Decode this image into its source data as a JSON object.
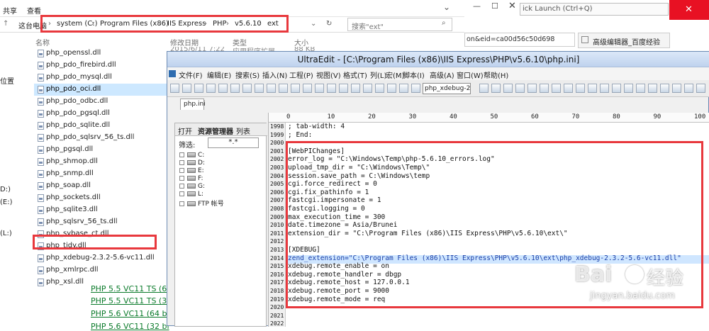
{
  "explorer": {
    "ribbon": {
      "share": "共享",
      "view": "查看"
    },
    "address": {
      "crumbs": [
        "这台电脑",
        "system (C:)",
        "Program Files (x86)",
        "IIS Express",
        "PHP",
        "v5.6.10",
        "ext"
      ],
      "sep": "›"
    },
    "search_placeholder": "搜索\"ext\"",
    "columns": {
      "name": "名称",
      "date": "修改日期",
      "type": "类型",
      "size": "大小"
    },
    "first_row": {
      "date": "2015/6/11 7:22",
      "type": "应用程序扩展",
      "size": "88 KB"
    },
    "nav": [
      "位置",
      "D:)",
      "(E:)",
      "(L:)"
    ],
    "files": [
      "php_openssl.dll",
      "php_pdo_firebird.dll",
      "php_pdo_mysql.dll",
      "php_pdo_oci.dll",
      "php_pdo_odbc.dll",
      "php_pdo_pgsql.dll",
      "php_pdo_sqlite.dll",
      "php_pdo_sqlsrv_56_ts.dll",
      "php_pgsql.dll",
      "php_shmop.dll",
      "php_snmp.dll",
      "php_soap.dll",
      "php_sockets.dll",
      "php_sqlite3.dll",
      "php_sqlsrv_56_ts.dll",
      "php_sybase_ct.dll",
      "php_tidy.dll",
      "php_xdebug-2.3.2-5.6-vc11.dll",
      "php_xmlrpc.dll",
      "php_xsl.dll"
    ],
    "selected_index": 3,
    "highlighted_index": 17,
    "links": [
      "PHP 5.5 VC11 TS (6",
      "PHP 5.5 VC11 TS (3",
      "PHP 5.6 VC11 (64 bi",
      "PHP 5.6 VC11 (32 bi"
    ]
  },
  "browser": {
    "quick_launch": "ick Launch (Ctrl+Q)",
    "url_fragment": "on&eid=ca00d56c50d698",
    "tab_title": "高级编辑器_百度经验"
  },
  "ultraedit": {
    "title": "UltraEdit - [C:\\Program Files (x86)\\IIS Express\\PHP\\v5.6.10\\php.ini]",
    "menu": [
      "文件(F)",
      "编辑(E)",
      "搜索(S)",
      "插入(N)",
      "工程(P)",
      "视图(V)",
      "格式(T)",
      "列(L)",
      "宏(M)",
      "脚本(I)",
      "高级(A)",
      "窗口(W)",
      "帮助(H)"
    ],
    "combo": "php_xdebug-2",
    "file_tab": "php.ini",
    "tree_tabs": [
      "打开",
      "资源管理器",
      "列表"
    ],
    "filter_label": "筛选:",
    "filter_value": "*.*",
    "drives": [
      "C:",
      "D:",
      "E:",
      "F:",
      "G:",
      "L:",
      "FTP 帐号"
    ],
    "ruler": [
      "0",
      "10",
      "20",
      "30",
      "40",
      "50",
      "60",
      "70",
      "80",
      "90",
      "100"
    ],
    "lines": [
      {
        "n": "1998",
        "t": "; tab-width: 4"
      },
      {
        "n": "1999",
        "t": "; End:"
      },
      {
        "n": "2000",
        "t": ""
      },
      {
        "n": "2001",
        "t": "[WebPIChanges]"
      },
      {
        "n": "2002",
        "t": "error_log = \"C:\\Windows\\Temp\\php-5.6.10_errors.log\""
      },
      {
        "n": "2003",
        "t": "upload_tmp_dir = \"C:\\Windows\\Temp\\\""
      },
      {
        "n": "2004",
        "t": "session.save_path = C:\\Windows\\temp"
      },
      {
        "n": "2005",
        "t": "cgi.force_redirect = 0"
      },
      {
        "n": "2006",
        "t": "cgi.fix_pathinfo = 1"
      },
      {
        "n": "2007",
        "t": "fastcgi.impersonate = 1"
      },
      {
        "n": "2008",
        "t": "fastcgi.logging = 0"
      },
      {
        "n": "2009",
        "t": "max_execution_time = 300"
      },
      {
        "n": "2010",
        "t": "date.timezone = Asia/Brunei"
      },
      {
        "n": "2011",
        "t": "extension_dir = \"C:\\Program Files (x86)\\IIS Express\\PHP\\v5.6.10\\ext\\\""
      },
      {
        "n": "2012",
        "t": ""
      },
      {
        "n": "2013",
        "t": "[XDEBUG]"
      },
      {
        "n": "2014",
        "t": "zend_extension=\"C:\\Program Files (x86)\\IIS Express\\PHP\\v5.6.10\\ext\\php_xdebug-2.3.2-5.6-vc11.dll\""
      },
      {
        "n": "2015",
        "t": "xdebug.remote_enable = on"
      },
      {
        "n": "2016",
        "t": "xdebug.remote_handler = dbgp"
      },
      {
        "n": "2017",
        "t": "xdebug.remote_host = 127.0.0.1"
      },
      {
        "n": "2018",
        "t": "xdebug.remote_port = 9000"
      },
      {
        "n": "2019",
        "t": "xdebug.remote_mode = req"
      },
      {
        "n": "2020",
        "t": ""
      },
      {
        "n": "2021",
        "t": ""
      },
      {
        "n": "2022",
        "t": ""
      }
    ],
    "current_line": 16
  },
  "watermark": {
    "brand": "Bai",
    "suffix": "经验",
    "url": "jingyan.baidu.com"
  },
  "colors": {
    "highlight_box": "#e8383d",
    "selection": "#cde8ff",
    "current_line": "#cfe6ff",
    "link": "#0a7a2a"
  }
}
